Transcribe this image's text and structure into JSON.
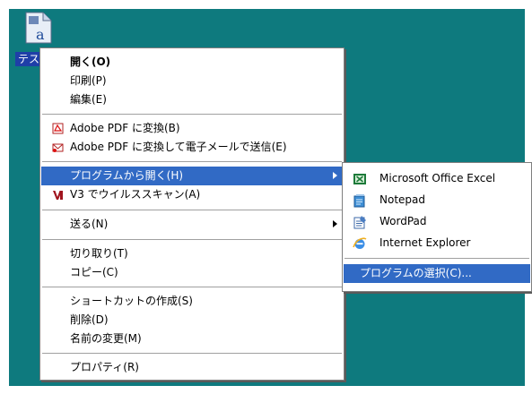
{
  "desktop": {
    "background": "#0e7a7e",
    "file_label": "テスト"
  },
  "context_menu": {
    "items": [
      {
        "label": "開く(O)",
        "icon": "none",
        "bold": true
      },
      {
        "label": "印刷(P)"
      },
      {
        "label": "編集(E)"
      },
      {
        "label": "Adobe PDF に変換(B)",
        "icon": "pdf-icon"
      },
      {
        "label": "Adobe PDF に変換して電子メールで送信(E)",
        "icon": "pdf-mail-icon"
      },
      {
        "label": "プログラムから開く(H)",
        "highlighted": true,
        "submenu": true
      },
      {
        "label": "V3 でウイルススキャン(A)",
        "icon": "v3-icon"
      },
      {
        "label": "送る(N)",
        "submenu": true
      },
      {
        "label": "切り取り(T)"
      },
      {
        "label": "コピー(C)"
      },
      {
        "label": "ショートカットの作成(S)"
      },
      {
        "label": "削除(D)"
      },
      {
        "label": "名前の変更(M)"
      },
      {
        "label": "プロパティ(R)"
      }
    ]
  },
  "open_with_submenu": {
    "items": [
      {
        "label": "Microsoft Office Excel",
        "icon": "excel-icon"
      },
      {
        "label": "Notepad",
        "icon": "notepad-icon"
      },
      {
        "label": "WordPad",
        "icon": "wordpad-icon"
      },
      {
        "label": "Internet Explorer",
        "icon": "internet-explorer-icon"
      },
      {
        "label": "プログラムの選択(C)...",
        "highlighted": true
      }
    ]
  },
  "colors": {
    "highlight": "#316ac5",
    "desktop": "#0e7a7e"
  }
}
